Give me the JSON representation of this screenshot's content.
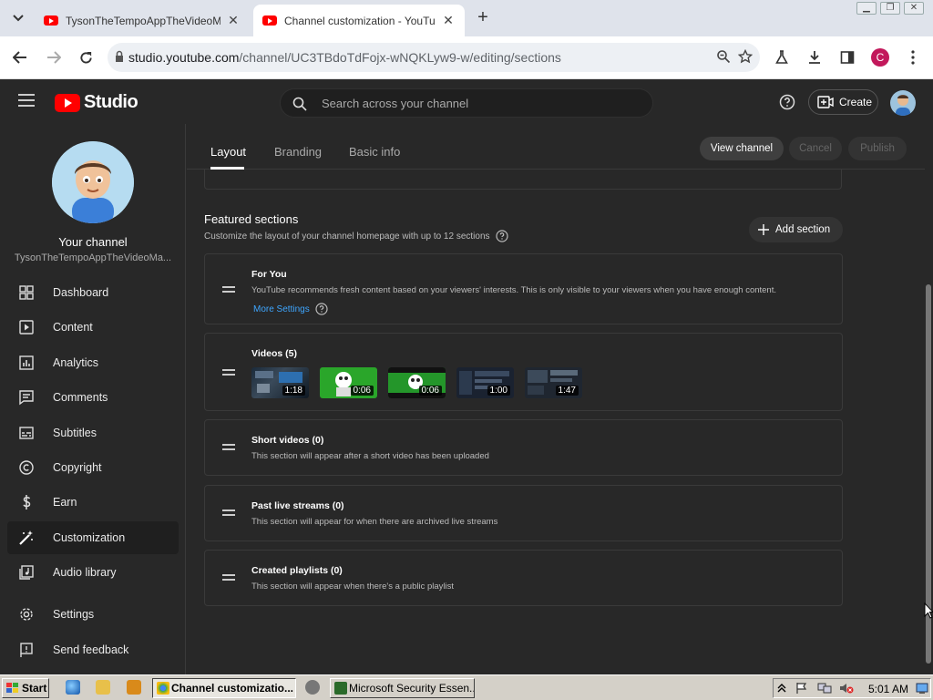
{
  "browser": {
    "tabs": [
      {
        "title": "TysonTheTempoAppTheVideoMaker",
        "active": false
      },
      {
        "title": "Channel customization - YouTube Studio",
        "active": true
      }
    ],
    "url_host": "studio.youtube.com",
    "url_path": "/channel/UC3TBdoTdFojx-wNQKLyw9-w/editing/sections",
    "profile_letter": "C",
    "window_controls": [
      "minimize",
      "restore",
      "close"
    ]
  },
  "studio": {
    "logo_text": "Studio",
    "search_placeholder": "Search across your channel",
    "create_label": "Create"
  },
  "sidebar": {
    "your_channel_label": "Your channel",
    "channel_name": "TysonTheTempoAppTheVideoMa...",
    "items": [
      {
        "label": "Dashboard",
        "icon": "dashboard-icon"
      },
      {
        "label": "Content",
        "icon": "content-icon"
      },
      {
        "label": "Analytics",
        "icon": "analytics-icon"
      },
      {
        "label": "Comments",
        "icon": "comments-icon"
      },
      {
        "label": "Subtitles",
        "icon": "subtitles-icon"
      },
      {
        "label": "Copyright",
        "icon": "copyright-icon"
      },
      {
        "label": "Earn",
        "icon": "earn-icon"
      },
      {
        "label": "Customization",
        "icon": "customization-icon",
        "active": true
      },
      {
        "label": "Audio library",
        "icon": "audio-library-icon"
      },
      {
        "label": "Settings",
        "icon": "settings-icon"
      },
      {
        "label": "Send feedback",
        "icon": "feedback-icon"
      }
    ]
  },
  "main": {
    "tabs": [
      {
        "label": "Layout",
        "active": true
      },
      {
        "label": "Branding"
      },
      {
        "label": "Basic info"
      }
    ],
    "view_channel_label": "View channel",
    "cancel_label": "Cancel",
    "publish_label": "Publish",
    "featured": {
      "title": "Featured sections",
      "description": "Customize the layout of your channel homepage with up to 12 sections",
      "add_section_label": "Add section"
    },
    "sections": [
      {
        "title": "For You",
        "description": "YouTube recommends fresh content based on your viewers' interests. This is only visible to your viewers when you have enough content.",
        "link": "More Settings"
      },
      {
        "title": "Videos (5)",
        "videos": [
          {
            "duration": "1:18"
          },
          {
            "duration": "0:06"
          },
          {
            "duration": "0:06"
          },
          {
            "duration": "1:00"
          },
          {
            "duration": "1:47"
          }
        ]
      },
      {
        "title": "Short videos (0)",
        "description": "This section will appear after a short video has been uploaded"
      },
      {
        "title": "Past live streams (0)",
        "description": "This section will appear for when there are archived live streams"
      },
      {
        "title": "Created playlists (0)",
        "description": "This section will appear when there's a public playlist"
      }
    ]
  },
  "taskbar": {
    "start_label": "Start",
    "tasks": [
      {
        "label": "Channel customizatio...",
        "active": true
      },
      {
        "label": "Microsoft Security Essen..."
      }
    ],
    "clock": "5:01 AM"
  },
  "colors": {
    "studio_bg": "#282828",
    "youtube_red": "#ff0000",
    "link_blue": "#3ea6ff",
    "taskbar_bg": "#d4d0c8"
  }
}
